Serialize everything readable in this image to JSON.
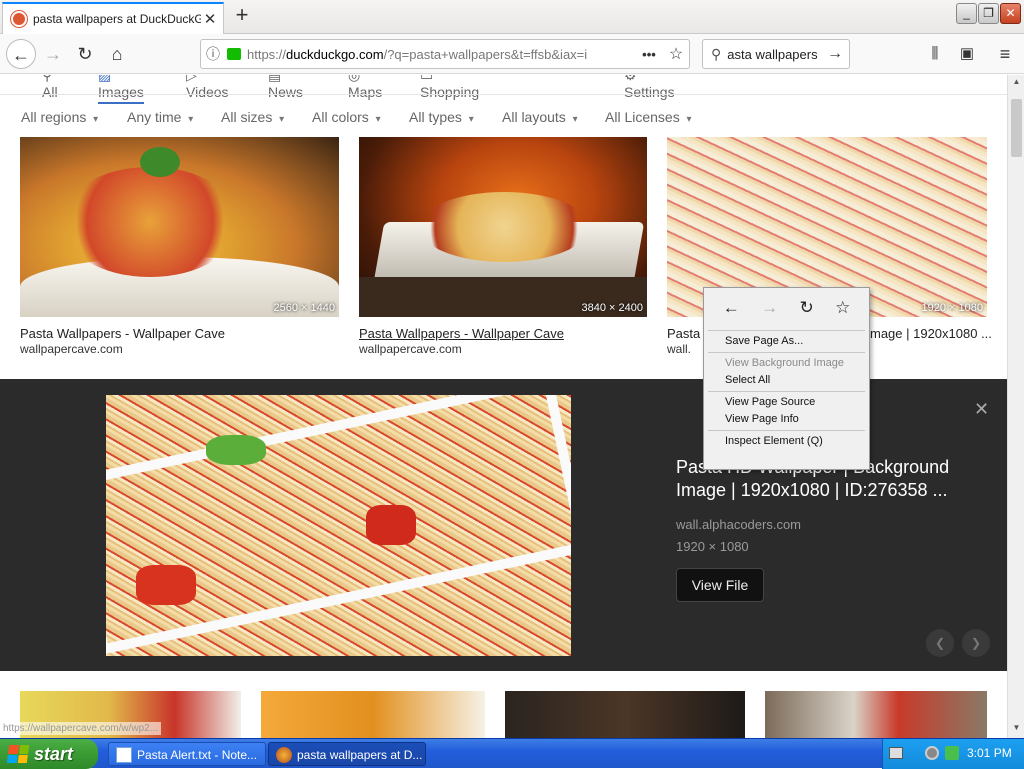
{
  "browser": {
    "tab_title": "pasta wallpapers at DuckDuckGo",
    "new_tab": "+",
    "url_prefix": "https://",
    "url_host": "duckduckgo.com",
    "url_path": "/?q=pasta+wallpapers&t=ffsb&iax=i",
    "search_query": "asta wallpapers"
  },
  "nav_tabs": [
    "All",
    "Images",
    "Videos",
    "News",
    "Maps",
    "Shopping",
    "Settings"
  ],
  "filters": [
    "All regions",
    "Any time",
    "All sizes",
    "All colors",
    "All types",
    "All layouts",
    "All Licenses"
  ],
  "results": [
    {
      "dims": "2560 × 1440",
      "title": "Pasta Wallpapers - Wallpaper Cave",
      "domain": "wallpapercave.com"
    },
    {
      "dims": "3840 × 2400",
      "title": "Pasta Wallpapers - Wallpaper Cave",
      "domain": "wallpapercave.com"
    },
    {
      "dims": "1920 × 1080",
      "title": "Pasta",
      "title_tail": "mage | 1920x1080 ...",
      "domain": "wall."
    }
  ],
  "preview": {
    "title": "Pasta HD Wallpaper | Background Image | 1920x1080 | ID:276358 ...",
    "site": "wall.alphacoders.com",
    "dims": "1920 × 1080",
    "button": "View File",
    "close": "✕"
  },
  "context_menu": {
    "items": [
      {
        "label": "Save Page As...",
        "enabled": true
      },
      {
        "label": "View Background Image",
        "enabled": false
      },
      {
        "label": "Select All",
        "enabled": true
      },
      {
        "label": "View Page Source",
        "enabled": true
      },
      {
        "label": "View Page Info",
        "enabled": true
      },
      {
        "label": "Inspect Element (Q)",
        "enabled": true
      }
    ]
  },
  "status_url": "https://wallpapercave.com/w/wp2...",
  "taskbar": {
    "start": "start",
    "items": [
      "Pasta Alert.txt - Note...",
      "pasta wallpapers at D..."
    ],
    "clock": "3:01 PM"
  },
  "colors": {
    "accent": "#0a84ff",
    "ddg": "#de5833",
    "preview_bg": "#2b2b2b",
    "taskbar": "#245edb",
    "start": "#3a9b33"
  }
}
